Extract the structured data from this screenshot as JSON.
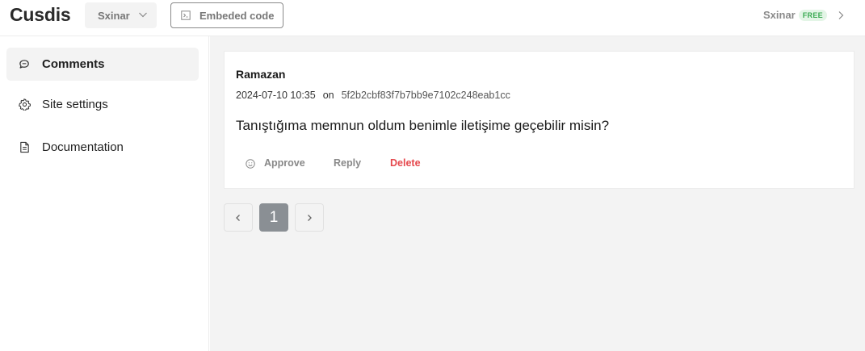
{
  "header": {
    "logo": "Cusdis",
    "site_select": {
      "value": "Sxinar"
    },
    "embed_button": {
      "label": "Embeded code"
    },
    "user": {
      "name": "Sxinar",
      "plan_badge": "FREE"
    }
  },
  "sidebar": {
    "items": [
      {
        "label": "Comments",
        "icon": "comments-icon",
        "active": true
      },
      {
        "label": "Site settings",
        "icon": "gear-icon",
        "active": false
      },
      {
        "label": "Documentation",
        "icon": "document-icon",
        "active": false
      }
    ]
  },
  "comments": [
    {
      "author": "Ramazan",
      "date": "2024-07-10 10:35",
      "on_label": "on",
      "page_id": "5f2b2cbf83f7b7bb9e7102c248eab1cc",
      "content": "Tanıştığıma memnun oldum benimle iletişime geçebilir misin?",
      "actions": {
        "approve": "Approve",
        "reply": "Reply",
        "delete": "Delete"
      }
    }
  ],
  "pagination": {
    "current_page": "1"
  },
  "colors": {
    "delete": "#e5484d",
    "badge_text": "#3aaa52",
    "badge_bg": "#e3f5e6",
    "active_page": "#8a8f94"
  }
}
